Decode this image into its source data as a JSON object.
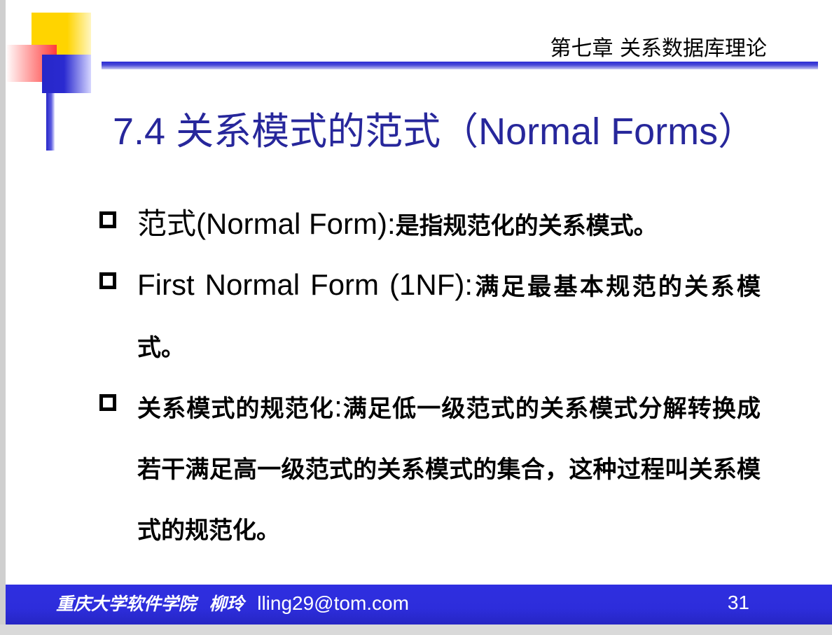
{
  "header": {
    "chapter": "第七章 关系数据库理论"
  },
  "title": "7.4  关系模式的范式（Normal Forms）",
  "bullets": [
    {
      "lead": "范式(Normal Form)",
      "sep": ":",
      "body": "是指规范化的关系模式。"
    },
    {
      "lead": "First Normal Form (1NF)",
      "sep": ":",
      "body": "满足最基本规范的关系模式。"
    },
    {
      "lead": "关系模式的规范化",
      "sep": ":",
      "body": "满足低一级范式的关系模式分解转换成若干满足高一级范式的关系模式的集合，这种过程叫关系模式的规范化。"
    }
  ],
  "footer": {
    "org": "重庆大学软件学院",
    "author": "柳玲",
    "email": "lling29@tom.com",
    "page_number": "31"
  },
  "colors": {
    "title": "#27279b",
    "footer_bg": "#2d2ddb",
    "accent_blue": "#2727c9",
    "accent_yellow": "#ffd400",
    "accent_red": "#ff3b3b"
  },
  "icons": [
    "checkbox-bullet-icon"
  ]
}
